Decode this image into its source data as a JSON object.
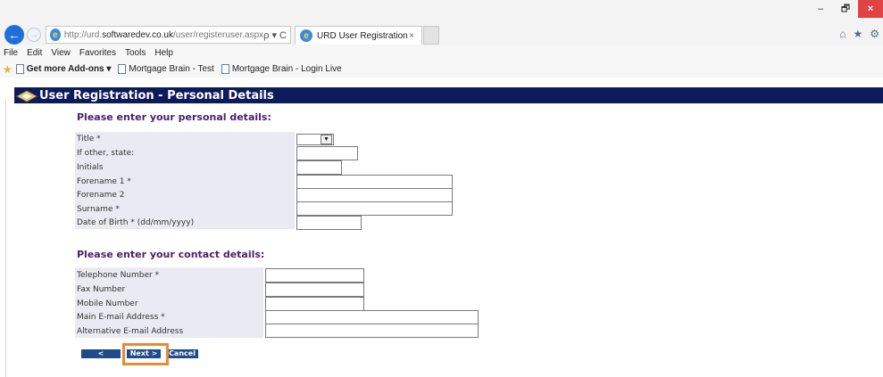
{
  "browser": {
    "url_prefix": "http://urd.",
    "url_domain": "softwaredev.co.uk",
    "url_path": "/user/registeruser.aspx",
    "address_tools": "ρ ▾ C",
    "tab_title": "URD User Registration",
    "tab_close": "×",
    "window_buttons": [
      "–",
      "🗗",
      "×"
    ],
    "right_icons": [
      "⌂",
      "★",
      "⚙"
    ],
    "back": "←",
    "forward": "→"
  },
  "menubar": {
    "items": [
      "File",
      "Edit",
      "View",
      "Favorites",
      "Tools",
      "Help"
    ]
  },
  "favorites": {
    "addons": "Get more Add-ons ▾",
    "links": [
      "Mortgage Brain - Test",
      "Mortgage Brain - Login Live"
    ]
  },
  "page": {
    "header_title": "User Registration - Personal Details",
    "personal_heading": "Please enter your personal details:",
    "contact_heading": "Please enter your contact details:",
    "personal_fields": {
      "title": {
        "label": "Title *",
        "value": ""
      },
      "if_other": {
        "label": "If other, state:",
        "value": ""
      },
      "initials": {
        "label": "Initials",
        "value": ""
      },
      "forename1": {
        "label": "Forename 1 *",
        "value": ""
      },
      "forename2": {
        "label": "Forename 2",
        "value": ""
      },
      "surname": {
        "label": "Surname *",
        "value": ""
      },
      "dob": {
        "label": "Date of Birth * (dd/mm/yyyy)",
        "value": ""
      }
    },
    "contact_fields": {
      "telephone": {
        "label": "Telephone Number *",
        "value": ""
      },
      "fax": {
        "label": "Fax Number",
        "value": ""
      },
      "mobile": {
        "label": "Mobile Number",
        "value": ""
      },
      "email_main": {
        "label": "Main E-mail Address *",
        "value": ""
      },
      "email_alt": {
        "label": "Alternative E-mail Address",
        "value": ""
      }
    },
    "buttons": {
      "previous": "< Previous",
      "next": "Next >",
      "cancel": "Cancel"
    }
  },
  "colors": {
    "header_band": "#0d1b5a",
    "heading": "#4b1f6e",
    "button": "#1e4b8a",
    "highlight": "#e58a36",
    "form_bg": "#eaeaf2"
  }
}
